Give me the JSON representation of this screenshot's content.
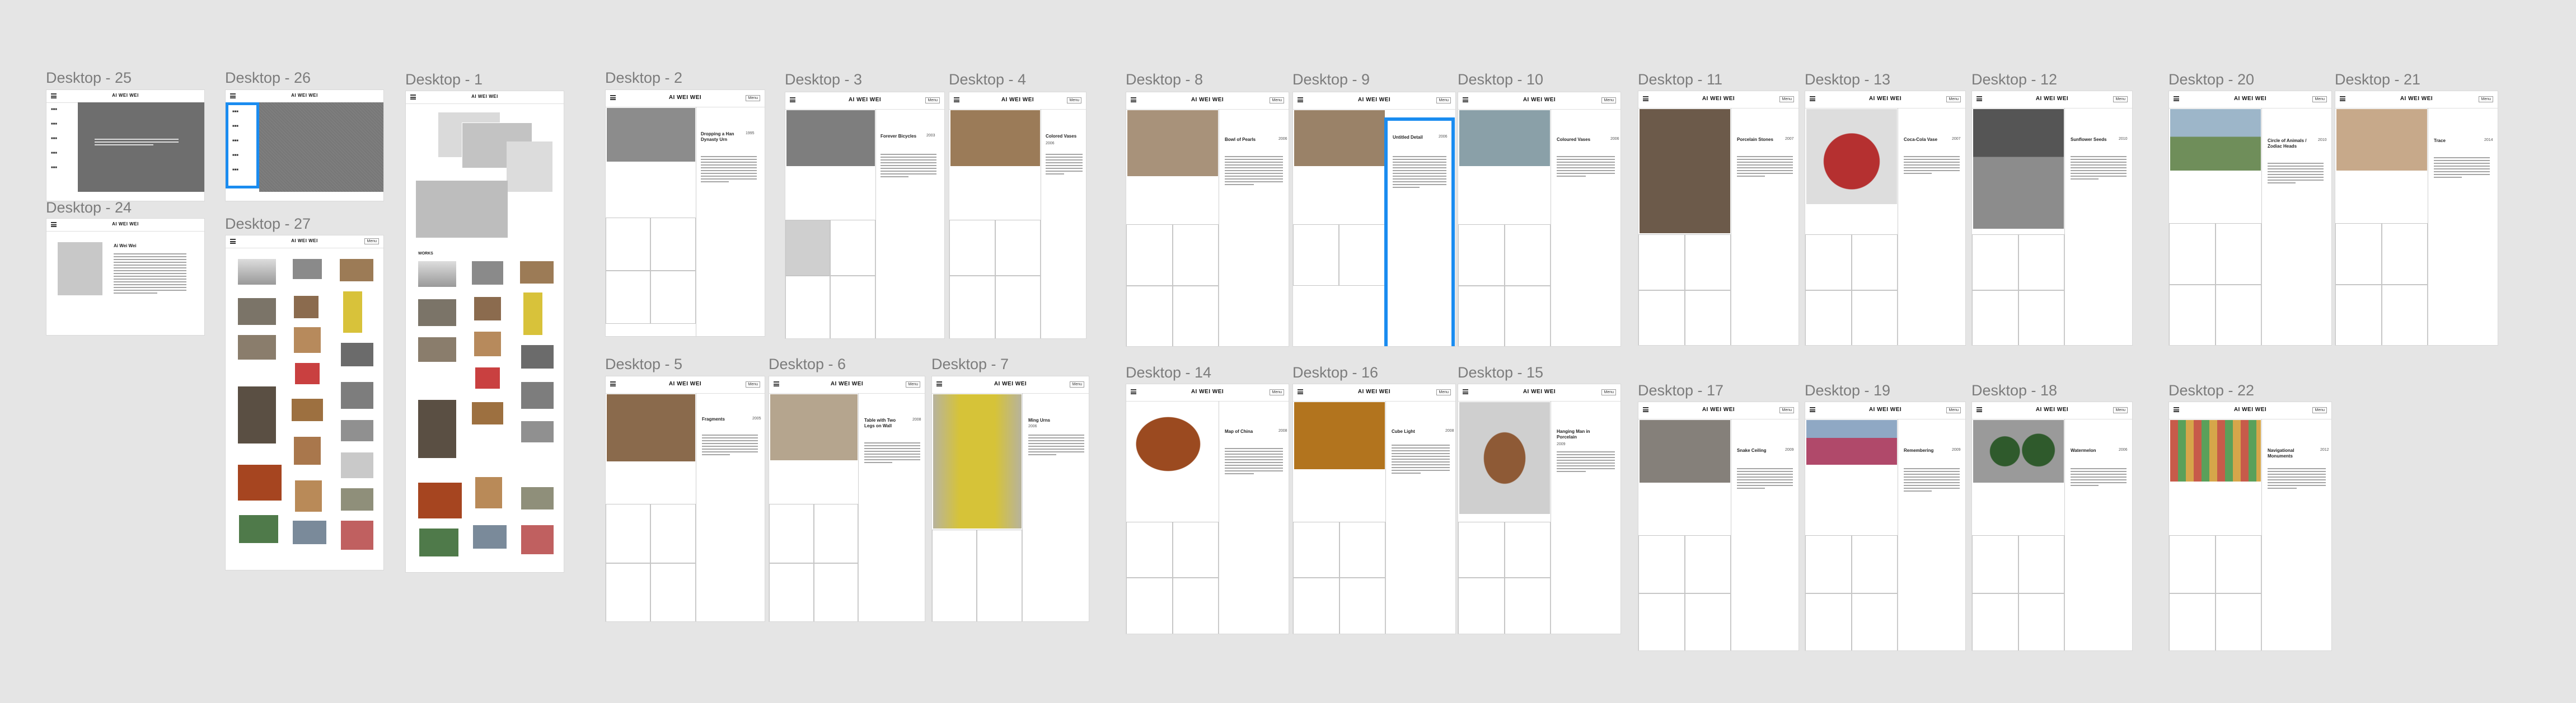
{
  "app": {
    "brand": "AI WEI WEI",
    "login": "Menu",
    "icons": [
      "share-icon",
      "heart-icon",
      "download-icon"
    ]
  },
  "colors": {
    "canvas": "#e5e5e5",
    "selection": "#1a8cf0",
    "placeholder": "#c8c8c8"
  },
  "frames": {
    "d25": {
      "label": "Desktop - 25"
    },
    "d26": {
      "label": "Desktop - 26"
    },
    "d1": {
      "label": "Desktop - 1",
      "section": "WORKS"
    },
    "d24": {
      "label": "Desktop - 24",
      "title": "Ai Wei Wei"
    },
    "d27": {
      "label": "Desktop - 27"
    },
    "d2": {
      "label": "Desktop - 2",
      "title": "Dropping a Han Dynasty Urn",
      "year": "1995"
    },
    "d3": {
      "label": "Desktop - 3",
      "title": "Forever Bicycles",
      "year": "2003"
    },
    "d4": {
      "label": "Desktop - 4",
      "title": "Colored Vases",
      "year": "2006"
    },
    "d8": {
      "label": "Desktop - 8",
      "title": "Bowl of Pearls",
      "year": "2006"
    },
    "d9": {
      "label": "Desktop - 9",
      "title": "Untitled Detail",
      "year": "2006"
    },
    "d10": {
      "label": "Desktop - 10",
      "title": "Coloured Vases",
      "year": "2006"
    },
    "d11": {
      "label": "Desktop - 11",
      "title": "Porcelain Stones",
      "year": "2007"
    },
    "d13": {
      "label": "Desktop - 13",
      "title": "Coca-Cola Vase",
      "year": "2007"
    },
    "d12": {
      "label": "Desktop - 12",
      "title": "Sunflower Seeds",
      "year": "2010"
    },
    "d20": {
      "label": "Desktop - 20",
      "title": "Circle of Animals / Zodiac Heads",
      "year": "2010"
    },
    "d21": {
      "label": "Desktop - 21",
      "title": "Trace",
      "year": "2014"
    },
    "d5": {
      "label": "Desktop - 5",
      "title": "Fragments",
      "year": "2005"
    },
    "d6": {
      "label": "Desktop - 6",
      "title": "Table with Two Legs on Wall",
      "year": "2008"
    },
    "d7": {
      "label": "Desktop - 7",
      "title": "Ming Urns",
      "year": "2006"
    },
    "d14": {
      "label": "Desktop - 14",
      "title": "Map of China",
      "year": "2008"
    },
    "d16": {
      "label": "Desktop - 16",
      "title": "Cube Light",
      "year": "2008"
    },
    "d15": {
      "label": "Desktop - 15",
      "title": "Hanging Man in Porcelain",
      "year": "2009"
    },
    "d17": {
      "label": "Desktop - 17",
      "title": "Snake Ceiling",
      "year": "2009"
    },
    "d19": {
      "label": "Desktop - 19",
      "title": "Remembering",
      "year": "2009"
    },
    "d18": {
      "label": "Desktop - 18",
      "title": "Watermelon",
      "year": "2006"
    },
    "d22": {
      "label": "Desktop - 22",
      "title": "Navigational Monuments",
      "year": "2012"
    }
  }
}
